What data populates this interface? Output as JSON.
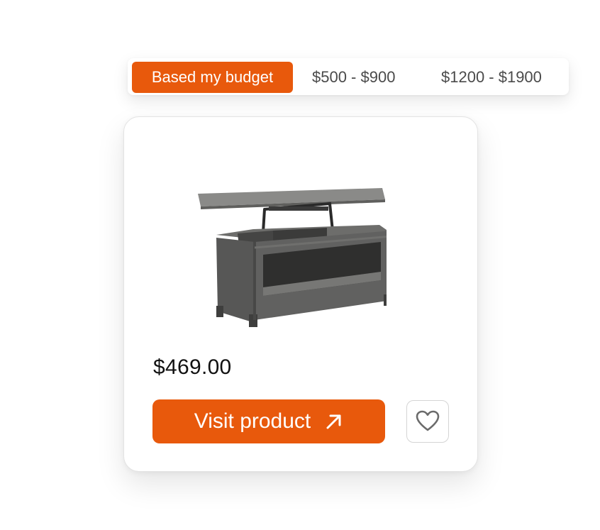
{
  "filters": {
    "tabs": [
      {
        "label": "Based my budget",
        "active": true
      },
      {
        "label": "$500 - $900",
        "active": false
      },
      {
        "label": "$1200 - $1900",
        "active": false
      }
    ]
  },
  "product": {
    "image_icon": "lift-top-coffee-table",
    "price": "$469.00",
    "visit_label": "Visit product",
    "visit_icon": "arrow-up-right-icon",
    "favorite_icon": "heart-icon"
  },
  "colors": {
    "accent": "#e8590c",
    "text": "#111111",
    "muted_text": "#4a4a4a"
  }
}
